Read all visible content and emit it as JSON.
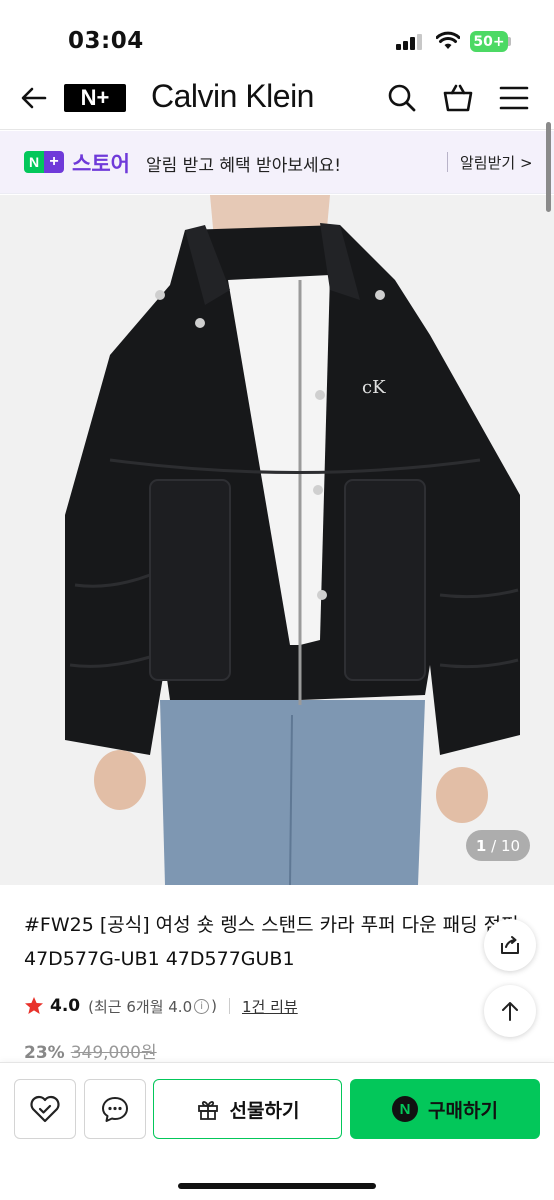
{
  "status_bar": {
    "time": "03:04",
    "battery": "50+"
  },
  "header": {
    "back_icon": "back-arrow-icon",
    "channel_logo": "N+",
    "brand": "Calvin Klein",
    "icons": [
      "search-icon",
      "cart-icon",
      "menu-icon"
    ]
  },
  "store_banner": {
    "badge": "N+",
    "title": "스토어",
    "message": "알림 받고 혜택 받아보세요!",
    "action": "알림받기 >"
  },
  "image": {
    "counter_current": "1",
    "counter_total": "/ 10"
  },
  "product": {
    "title": "#FW25 [공식] 여성 숏 렝스 스탠드 카라 푸퍼 다운 패딩 점퍼 47D577G-UB1 47D577GUB1",
    "rating": "4.0",
    "rating_detail_open": "(최근 6개월 4.0",
    "rating_detail_close": ")",
    "review_link": "1건 리뷰",
    "discount": "23%",
    "original_price": "349,000원"
  },
  "bottom_bar": {
    "gift_label": "선물하기",
    "buy_label": "구매하기",
    "npay_mark": "N"
  },
  "colors": {
    "naver_green": "#03c75a",
    "store_purple": "#6f3ad9",
    "star_red": "#e8322b"
  }
}
